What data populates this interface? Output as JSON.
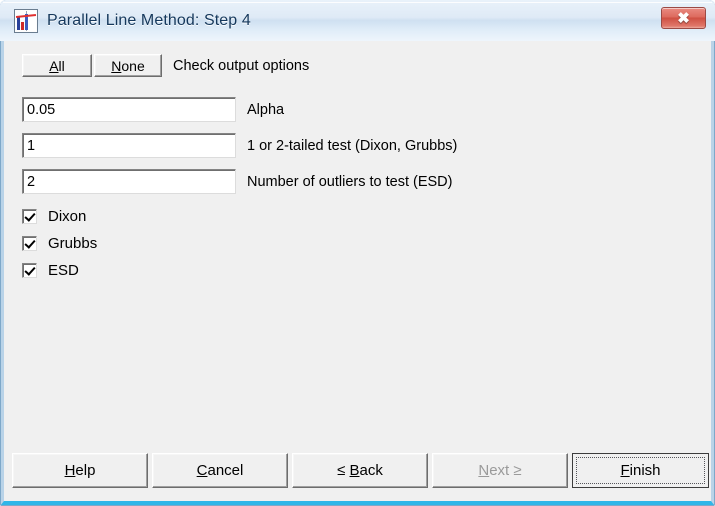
{
  "window": {
    "title": "Parallel Line Method: Step 4",
    "app_icon": "spreadsheet-chart-icon",
    "close_label": "✖",
    "titlebar_color": "#cfe0f1",
    "client_color": "#f0f0f0",
    "accent_border_color": "#2fb6e8"
  },
  "toolbar": {
    "all_label": "All",
    "all_accel": "A",
    "none_label": "None",
    "none_accel": "N",
    "instruction": "Check output options"
  },
  "fields": [
    {
      "name": "alpha",
      "value": "0.05",
      "placeholder": "",
      "label": "Alpha"
    },
    {
      "name": "tails",
      "value": "1",
      "placeholder": "",
      "label": "1 or 2-tailed test (Dixon, Grubbs)"
    },
    {
      "name": "outliers",
      "value": "2",
      "placeholder": "",
      "label": "Number of outliers to test (ESD)"
    }
  ],
  "checkboxes": [
    {
      "name": "dixon",
      "label": "Dixon",
      "checked": true
    },
    {
      "name": "grubbs",
      "label": "Grubbs",
      "checked": true
    },
    {
      "name": "esd",
      "label": "ESD",
      "checked": true
    }
  ],
  "buttons": {
    "help": {
      "label": "Help",
      "accel": "H",
      "prefix": "",
      "suffix": "",
      "enabled": true,
      "default": false
    },
    "cancel": {
      "label": "Cancel",
      "accel": "C",
      "prefix": "",
      "suffix": "",
      "enabled": true,
      "default": false
    },
    "back": {
      "label": "Back",
      "accel": "B",
      "prefix": "≤ ",
      "suffix": "",
      "enabled": true,
      "default": false
    },
    "next": {
      "label": "Next",
      "accel": "N",
      "prefix": "",
      "suffix": " ≥",
      "enabled": false,
      "default": false
    },
    "finish": {
      "label": "Finish",
      "accel": "F",
      "prefix": "",
      "suffix": "",
      "enabled": true,
      "default": true
    }
  }
}
